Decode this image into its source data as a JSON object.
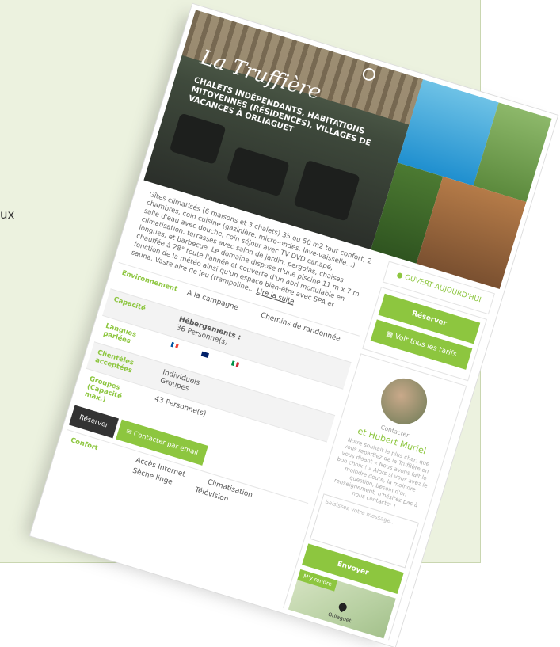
{
  "side_text": "ux",
  "hero": {
    "logo": "La Truffière",
    "subtitle": "CHALETS INDÉPENDANTS, HABITATIONS MITOYENNES (RÉSIDENCES), VILLAGES DE VACANCES À ORLIAGUET"
  },
  "description": {
    "text": "Gîtes climatisés (6 maisons et 3 chalets) 35 ou 50 m2 tout confort, 2 chambres, coin cuisine (gazinière, micro-ondes, lave-vaisselle...) salle d'eau avec douche, coin séjour avec TV DVD canapé, climatisation, terrasses avec salon de jardin, pergolas, chaises longues, et barbecue. Le domaine dispose d'une piscine 11 m x 7 m chauffée à 28° toute l'année et couverte d'un abri modulable en fonction de la météo ainsi qu'un espace bien-être avec SPA et sauna. Vaste aire de jeu (trampoline...",
    "more": "Lire la suite"
  },
  "info_rows": [
    {
      "label": "Environnement",
      "values": [
        "A la campagne",
        "Chemins de randonnée"
      ]
    },
    {
      "label": "Capacité",
      "values": [
        "Hébergements :",
        "36 Personne(s)"
      ]
    },
    {
      "label": "Langues parlées",
      "values": []
    },
    {
      "label": "Clientèles acceptées",
      "values": [
        "Individuels",
        "Groupes"
      ]
    },
    {
      "label": "Groupes (Capacité max.)",
      "values": [
        "43 Personne(s)"
      ]
    }
  ],
  "buttons": {
    "reserve_dark": "Réserver",
    "contact_email": "Contacter par email"
  },
  "confort": {
    "label": "Confort",
    "values": [
      "Accès Internet",
      "Climatisation",
      "Sèche linge",
      "Télévision"
    ]
  },
  "sidebar": {
    "open_status": "OUVERT AUJOURD'HUI",
    "reserve": "Réserver",
    "all_rates": "Voir tous les tarifs",
    "contact_label": "Contacter",
    "contact_name": "et Hubert Muriel",
    "contact_text": "Notre souhait le plus cher, que vous repartiez de la Truffière en vous disant « Nous avons fait le bon choix ! » Alors si vous avez le moindre doute, la moindre question, besoin d'un renseignement, n'hésitez pas à nous contacter !",
    "message_placeholder": "Saisissez votre message...",
    "send": "Envoyer",
    "map_tab": "M'y rendre",
    "map_place": "Orliaguet"
  },
  "colors": {
    "accent": "#8dc63f",
    "dark": "#333333"
  }
}
